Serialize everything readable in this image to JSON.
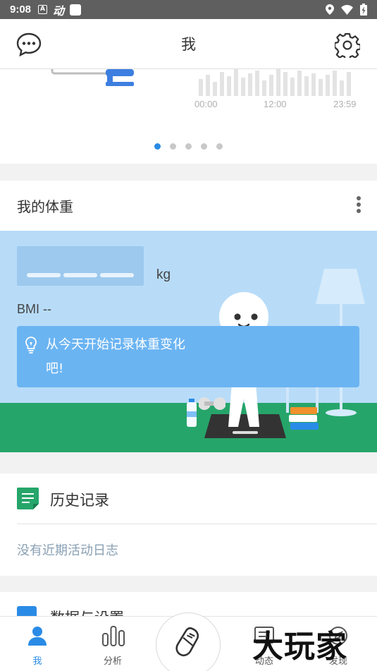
{
  "status_bar": {
    "time": "9:08",
    "notification_a": "A",
    "notification_app": "动"
  },
  "header": {
    "title": "我"
  },
  "banner": {
    "activity_ticks": [
      "00:00",
      "12:00",
      "23:59"
    ],
    "page_count": 5,
    "active_page": 1
  },
  "weight_card": {
    "title": "我的体重",
    "unit": "kg",
    "bmi_text": "BMI --",
    "tip_line1": "从今天开始记录体重变化",
    "tip_line2": "吧!"
  },
  "history_card": {
    "title": "历史记录",
    "empty_text": "没有近期活动日志"
  },
  "settings_card": {
    "title": "数据与设置"
  },
  "bottom_nav": {
    "items": [
      {
        "label": "我",
        "icon": "person-icon",
        "active": true
      },
      {
        "label": "分析",
        "icon": "bar-chart-icon",
        "active": false
      },
      {
        "label": "",
        "icon": "shoe-icon",
        "active": false
      },
      {
        "label": "动态",
        "icon": "feed-icon",
        "active": false
      },
      {
        "label": "发现",
        "icon": "discover-icon",
        "active": false
      }
    ]
  },
  "watermark": "大玩家",
  "colors": {
    "accent": "#2a8be6",
    "sky": "#b8dcf8",
    "floor": "#26a56a",
    "tip_bg": "#6bb4f2"
  }
}
